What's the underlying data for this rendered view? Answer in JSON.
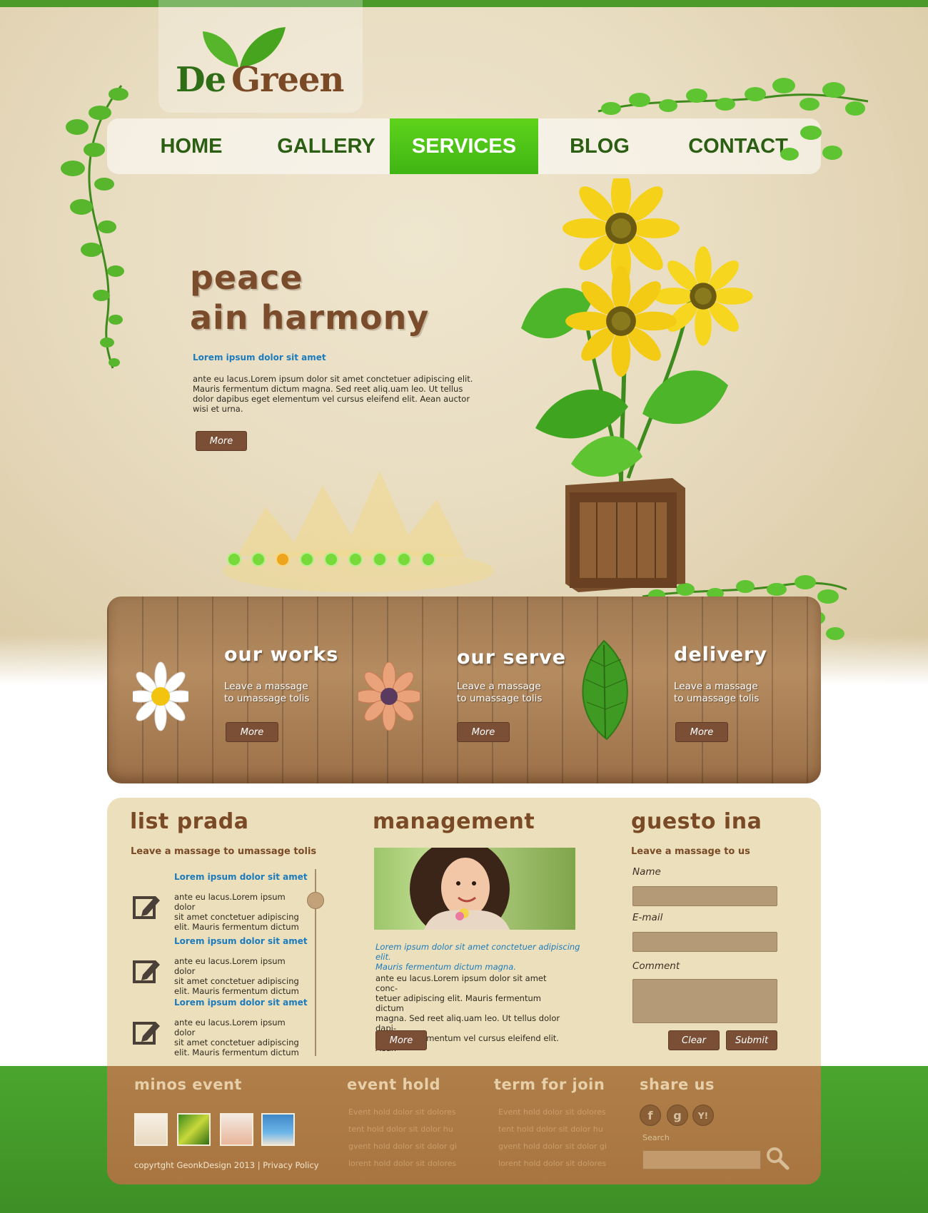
{
  "brand": {
    "logo_word1": "De",
    "logo_word2": "Green"
  },
  "nav": {
    "items": [
      {
        "label": "HOME"
      },
      {
        "label": "GALLERY"
      },
      {
        "label": "SERVICES"
      },
      {
        "label": "BLOG"
      },
      {
        "label": "CONTACT"
      }
    ],
    "active": "SERVICES"
  },
  "hero": {
    "title_line1": "peace",
    "title_line2": "ain harmony",
    "subtitle": "Lorem ipsum dolor sit amet",
    "body": "ante eu lacus.Lorem ipsum dolor sit amet conctetuer adipiscing elit. Mauris fermentum dictum magna. Sed reet aliq.uam leo. Ut tellus dolor dapibus eget elementum vel cursus eleifend elit. Aean auctor wisi et urna.",
    "button": "More",
    "slide_count": 9,
    "active_slide": 3
  },
  "features": [
    {
      "title": "our works",
      "text_line1": "Leave a massage",
      "text_line2": "to umassage tolis",
      "button": "More",
      "icon": "daisy-icon"
    },
    {
      "title": "our serve",
      "text_line1": "Leave a massage",
      "text_line2": "to umassage tolis",
      "button": "More",
      "icon": "flower-icon"
    },
    {
      "title": "delivery",
      "text_line1": "Leave a massage",
      "text_line2": "to umassage tolis",
      "button": "More",
      "icon": "leaf-icon"
    }
  ],
  "list_prada": {
    "title": "list prada",
    "subtitle": "Leave a massage to umassage tolis",
    "items": [
      {
        "head": "Lorem ipsum dolor sit amet",
        "l1": "ante eu lacus.Lorem ipsum dolor",
        "l2": "sit amet conctetuer adipiscing",
        "l3": "elit. Mauris fermentum dictum"
      },
      {
        "head": "Lorem ipsum dolor sit amet",
        "l1": "ante eu lacus.Lorem ipsum dolor",
        "l2": "sit amet conctetuer adipiscing",
        "l3": "elit. Mauris fermentum dictum"
      },
      {
        "head": "Lorem ipsum dolor sit amet",
        "l1": "ante eu lacus.Lorem ipsum dolor",
        "l2": "sit amet conctetuer adipiscing",
        "l3": "elit. Mauris fermentum dictum"
      }
    ]
  },
  "management": {
    "title": "management",
    "italic_l1": "Lorem ipsum dolor sit amet conctetuer adipiscing elit.",
    "italic_l2": "Mauris fermentum dictum magna.",
    "body_l1": "ante eu lacus.Lorem ipsum dolor sit amet conc-",
    "body_l2": "tetuer adipiscing elit. Mauris fermentum dictum",
    "body_l3": "magna. Sed reet aliq.uam leo. Ut tellus dolor dapi-",
    "body_l4": "bus eget elementum vel cursus eleifend elit. Aean",
    "button": "More"
  },
  "guestbook": {
    "title": "guesto ina",
    "subtitle": "Leave a massage to us",
    "name_label": "Name",
    "email_label": "E-mail",
    "comment_label": "Comment",
    "clear_button": "Clear",
    "submit_button": "Submit"
  },
  "footer": {
    "col1_title": "minos event",
    "copyright": "copyrtght GeonkDesign 2013 | Privacy Policy",
    "col2_title": "event hold",
    "col2_links": [
      "Event hold dolor sit dolores",
      "tent hold dolor sit dolor hu",
      "gvent hold dolor sit dolor gi",
      "lorent hold dolor sit dolores"
    ],
    "col3_title": "term for join",
    "col3_links": [
      "Event hold dolor sit dolores",
      "tent hold dolor sit dolor hu",
      "gvent hold dolor sit dolor gi",
      "lorent hold dolor sit dolores"
    ],
    "col4_title": "share us",
    "social": [
      {
        "glyph": "f",
        "icon": "facebook-icon"
      },
      {
        "glyph": "g",
        "icon": "google-icon"
      },
      {
        "glyph": "Y!",
        "icon": "yahoo-icon"
      }
    ],
    "search_label": "Search"
  }
}
